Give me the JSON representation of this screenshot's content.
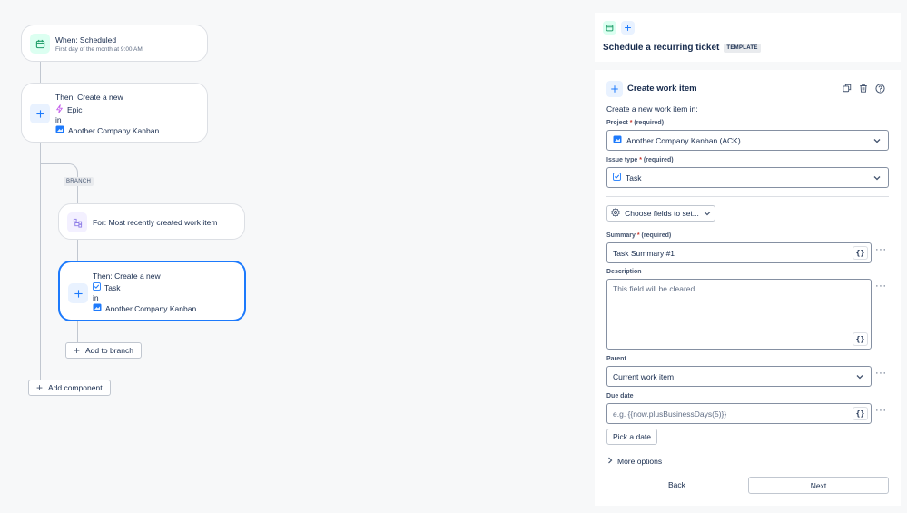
{
  "flow": {
    "trigger": {
      "title": "When: Scheduled",
      "subtitle": "First day of the month at 9:00 AM"
    },
    "action1": {
      "title": "Then: Create a new",
      "type": "Epic",
      "in_label": "in",
      "project": "Another Company Kanban"
    },
    "branch_tag": "BRANCH",
    "branch": {
      "title": "For: Most recently created work item"
    },
    "action2": {
      "title": "Then: Create a new",
      "type": "Task",
      "in_label": "in",
      "project": "Another Company Kanban"
    },
    "add_to_branch": "Add to branch",
    "add_component": "Add component"
  },
  "panel": {
    "header_title": "Schedule a recurring ticket",
    "template_tag": "TEMPLATE",
    "section_title": "Create work item",
    "intro": "Create a new work item in:",
    "project": {
      "label": "Project",
      "asterisk": "*",
      "required": "(required)",
      "value": "Another Company Kanban (ACK)"
    },
    "issue_type": {
      "label": "Issue type",
      "asterisk": "*",
      "required": "(required)",
      "value": "Task"
    },
    "choose_fields": "Choose fields to set...",
    "summary": {
      "label": "Summary",
      "asterisk": "*",
      "required": "(required)",
      "value": "Task Summary #1"
    },
    "description": {
      "label": "Description",
      "placeholder": "This field will be cleared"
    },
    "parent": {
      "label": "Parent",
      "value": "Current work item"
    },
    "due_date": {
      "label": "Due date",
      "placeholder": "e.g. {{now.plusBusinessDays(5)}}"
    },
    "pick_date": "Pick a date",
    "more_options": "More options",
    "back": "Back",
    "next": "Next",
    "curly": "{}",
    "dots": "···"
  },
  "colors": {
    "accent": "#1d7afc",
    "trigger_icon_bg": "#dcfff1",
    "trigger_icon": "#22a06b",
    "epic": "#c35aeb",
    "branch_icon": "#8f7ee7",
    "required": "#c9372c"
  }
}
